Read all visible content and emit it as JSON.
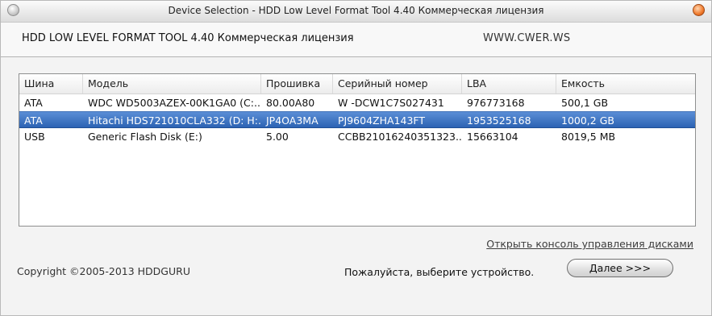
{
  "window": {
    "title": "Device Selection - HDD Low Level Format Tool 4.40    Коммерческая лицензия"
  },
  "header": {
    "product": "HDD LOW LEVEL FORMAT TOOL 4.40    Коммерческая лицензия",
    "website": "WWW.CWER.WS"
  },
  "table": {
    "columns": [
      "Шина",
      "Модель",
      "Прошивка",
      "Серийный номер",
      "LBA",
      "Емкость"
    ],
    "rows": [
      [
        "ATA",
        "WDC WD5003AZEX-00K1GA0 (C:...",
        "80.00A80",
        "W -DCW1C7S027431",
        "976773168",
        "500,1 GB"
      ],
      [
        "ATA",
        "Hitachi HDS721010CLA332 (D: H:...",
        "JP4OA3MA",
        "PJ9604ZHA143FT",
        "1953525168",
        "1000,2 GB"
      ],
      [
        "USB",
        "Generic Flash Disk (E:)",
        "5.00",
        "CCBB21016240351323...",
        "15663104",
        "8019,5 MB"
      ]
    ],
    "selected_row": 1
  },
  "footer": {
    "console_link": "Открыть консоль управления дисками",
    "copyright": "Copyright ©2005-2013 HDDGURU",
    "status": "Пожалуйста, выберите устройство.",
    "next_button": "Далее >>>"
  },
  "colors": {
    "selection": "#2c63b3",
    "window_bg": "#f3f3f3"
  },
  "icons": {
    "title_left": "app-circle-icon",
    "title_right": "close-icon"
  }
}
